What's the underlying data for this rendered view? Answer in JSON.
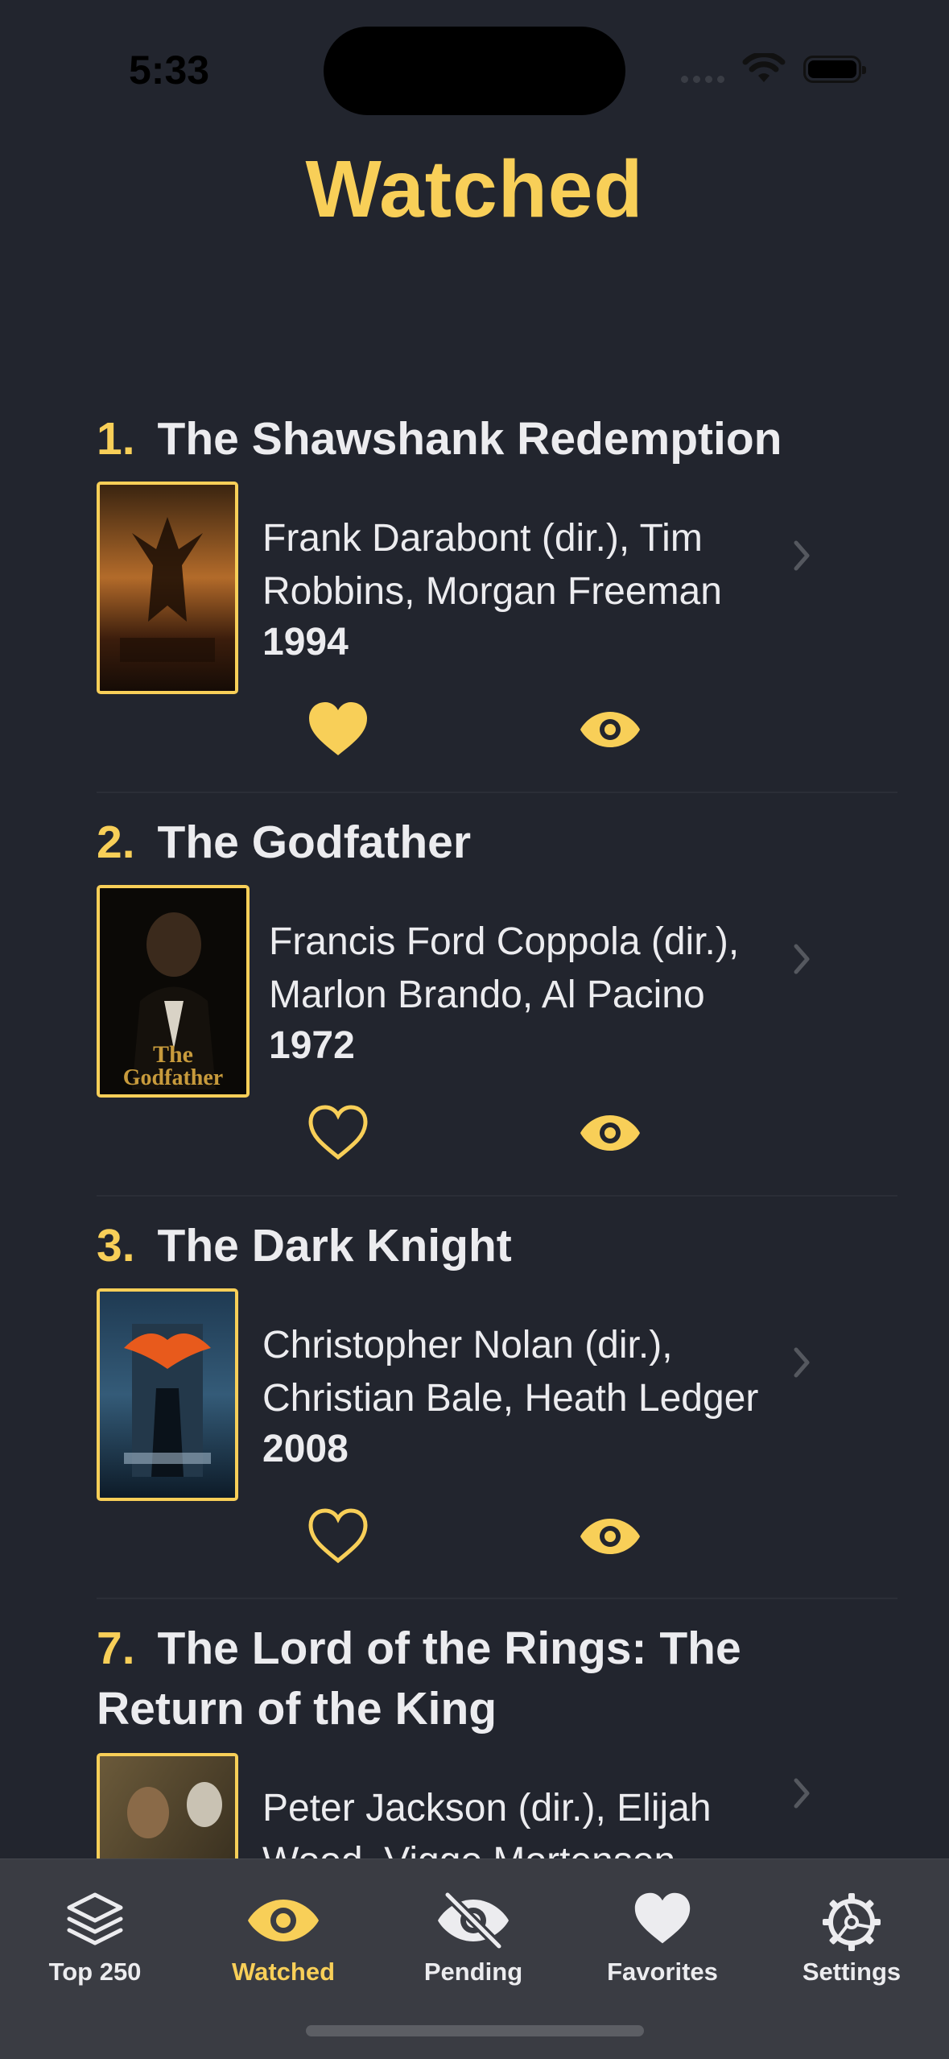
{
  "status": {
    "time": "5:33"
  },
  "title": "Watched",
  "movies": [
    {
      "rank": "1.",
      "title": "The Shawshank Redemption",
      "credits": "Frank Darabont (dir.), Tim Robbins, Morgan Freeman",
      "year": "1994",
      "favorite": true,
      "watched": true
    },
    {
      "rank": "2.",
      "title": "The Godfather",
      "credits": "Francis Ford Coppola (dir.), Marlon Brando, Al Pacino",
      "year": "1972",
      "favorite": false,
      "watched": true
    },
    {
      "rank": "3.",
      "title": "The Dark Knight",
      "credits": "Christopher Nolan (dir.), Christian Bale, Heath Ledger",
      "year": "2008",
      "favorite": false,
      "watched": true
    },
    {
      "rank": "7.",
      "title": "The Lord of the Rings: The Return of the King",
      "credits": "Peter Jackson (dir.), Elijah Wood, Viggo Mortensen",
      "favorite": false,
      "watched": true
    }
  ],
  "tabs": [
    {
      "label": "Top 250",
      "icon": "layers-icon"
    },
    {
      "label": "Watched",
      "icon": "eye-icon",
      "active": true
    },
    {
      "label": "Pending",
      "icon": "eye-slash-icon"
    },
    {
      "label": "Favorites",
      "icon": "heart-icon"
    },
    {
      "label": "Settings",
      "icon": "gear-icon"
    }
  ],
  "colors": {
    "accent": "#f8cf58",
    "background": "#22252e",
    "tab_bar": "#3a3c43"
  }
}
